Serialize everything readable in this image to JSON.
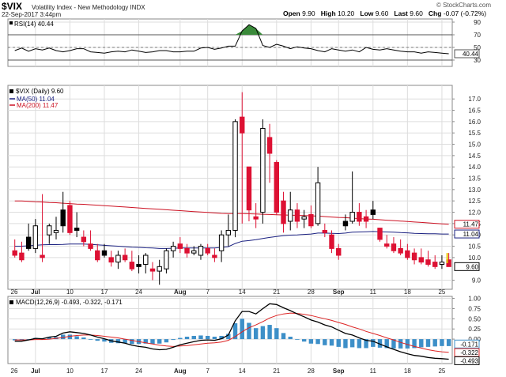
{
  "header": {
    "symbol": "$VIX",
    "company": "Volatility Index - New Methodology  INDX",
    "date": "22-Sep-2017 3:44pm",
    "brand": "© StockCharts.com",
    "open_label": "Open",
    "open": "9.90",
    "high_label": "High",
    "high": "10.20",
    "low_label": "Low",
    "low": "9.60",
    "last_label": "Last",
    "last": "9.60",
    "chg_label": "Chg",
    "chg": "-0.07 (-0.72%)"
  },
  "colors": {
    "up_candle": "#ffffff",
    "down_candle": "#dd1133",
    "black_candle": "#000000",
    "ma50": "#1a2080",
    "ma200": "#cc1122",
    "macd_line": "#000000",
    "signal_line": "#dd2222",
    "histogram": "#3d8fc8",
    "rsi_overbought_fill": "#3a8a3a",
    "grid": "#dddddd"
  },
  "chart_data": [
    {
      "type": "line",
      "panel": "rsi",
      "legend": "RSI(14) 40.44",
      "last_value_label": "40.44",
      "ylim": [
        20,
        95
      ],
      "y_ticks": [
        30,
        50,
        70,
        90
      ],
      "values": [
        45,
        49,
        44,
        48,
        46,
        49,
        45,
        43,
        45,
        48,
        48,
        43,
        42,
        41,
        43,
        44,
        43,
        46,
        44,
        42,
        43,
        45,
        45,
        43,
        43,
        44,
        44,
        49,
        50,
        47,
        49,
        52,
        52,
        76,
        86,
        80,
        53,
        50,
        55,
        52,
        48,
        51,
        49,
        48,
        45,
        43,
        48,
        46,
        44,
        46,
        43,
        50,
        47,
        46,
        48,
        46,
        44,
        43,
        43,
        41,
        43,
        42,
        41,
        40
      ]
    },
    {
      "type": "candlestick",
      "panel": "price",
      "legend": [
        "$VIX (Daily) 9.60",
        "MA(50) 11.04",
        "MA(200) 11.47"
      ],
      "last_value_labels": [
        "11.47",
        "11.04",
        "9.60"
      ],
      "ylim": [
        8.6,
        17.6
      ],
      "y_ticks": [
        9.0,
        10.0,
        10.5,
        11.0,
        11.5,
        12.0,
        12.5,
        13.0,
        13.5,
        14.0,
        14.5,
        15.0,
        15.5,
        16.0,
        16.5,
        17.0
      ],
      "ohlc": [
        [
          10.3,
          10.8,
          10.0,
          10.1
        ],
        [
          10.2,
          10.7,
          9.8,
          9.9
        ],
        [
          10.9,
          11.5,
          10.3,
          10.4
        ],
        [
          10.4,
          11.7,
          10.2,
          11.4
        ],
        [
          10.1,
          12.8,
          9.8,
          10.0
        ],
        [
          11.0,
          11.5,
          10.6,
          11.4
        ],
        [
          11.1,
          11.8,
          10.8,
          11.2
        ],
        [
          12.1,
          12.9,
          11.1,
          11.4
        ],
        [
          12.3,
          12.5,
          11.0,
          11.1
        ],
        [
          11.3,
          12.0,
          10.9,
          11.2
        ],
        [
          10.9,
          11.2,
          10.5,
          10.7
        ],
        [
          10.6,
          11.2,
          10.3,
          10.4
        ],
        [
          10.3,
          10.6,
          9.8,
          9.9
        ],
        [
          10.3,
          10.6,
          10.0,
          10.1
        ],
        [
          10.0,
          10.3,
          9.6,
          9.8
        ],
        [
          9.8,
          10.3,
          9.5,
          10.1
        ],
        [
          10.1,
          10.4,
          9.8,
          9.9
        ],
        [
          9.8,
          10.3,
          9.4,
          9.5
        ],
        [
          9.7,
          10.1,
          9.3,
          9.6
        ],
        [
          9.7,
          10.2,
          9.3,
          10.1
        ],
        [
          9.5,
          9.8,
          9.0,
          9.4
        ],
        [
          9.4,
          9.9,
          8.8,
          9.6
        ],
        [
          9.5,
          10.4,
          9.3,
          10.3
        ],
        [
          10.3,
          10.7,
          10.0,
          10.5
        ],
        [
          10.6,
          10.9,
          10.2,
          10.4
        ],
        [
          10.4,
          10.6,
          10.0,
          10.2
        ],
        [
          10.2,
          10.5,
          10.1,
          10.3
        ],
        [
          10.1,
          10.6,
          9.9,
          10.5
        ],
        [
          10.4,
          10.6,
          10.1,
          10.2
        ],
        [
          10.1,
          10.4,
          9.8,
          10.0
        ],
        [
          10.3,
          11.2,
          9.8,
          11.0
        ],
        [
          11.0,
          11.9,
          10.5,
          11.2
        ],
        [
          11.2,
          16.1,
          10.9,
          16.0
        ],
        [
          16.2,
          17.3,
          11.5,
          15.5
        ],
        [
          14.0,
          14.0,
          11.6,
          12.1
        ],
        [
          11.8,
          12.4,
          11.3,
          11.7
        ],
        [
          12.0,
          16.1,
          11.5,
          15.7
        ],
        [
          15.3,
          15.9,
          13.3,
          14.6
        ],
        [
          14.2,
          14.3,
          11.9,
          12.0
        ],
        [
          12.5,
          12.9,
          11.1,
          11.5
        ],
        [
          11.6,
          12.9,
          11.2,
          12.1
        ],
        [
          12.1,
          12.4,
          11.3,
          11.6
        ],
        [
          11.7,
          12.1,
          11.3,
          11.8
        ],
        [
          11.9,
          12.3,
          11.3,
          11.4
        ],
        [
          11.5,
          14.0,
          11.4,
          13.3
        ],
        [
          11.2,
          11.5,
          10.9,
          11.1
        ],
        [
          11.0,
          11.2,
          10.2,
          10.4
        ],
        [
          10.4,
          10.6,
          9.9,
          10.1
        ],
        [
          11.6,
          11.9,
          11.2,
          11.4
        ],
        [
          11.6,
          13.8,
          11.5,
          12.0
        ],
        [
          12.0,
          12.4,
          11.4,
          11.6
        ],
        [
          11.8,
          12.1,
          11.3,
          11.6
        ],
        [
          12.1,
          12.5,
          11.7,
          11.9
        ],
        [
          11.3,
          11.3,
          10.7,
          10.8
        ],
        [
          10.6,
          11.0,
          10.4,
          10.5
        ],
        [
          10.6,
          10.9,
          10.2,
          10.3
        ],
        [
          10.4,
          10.8,
          10.1,
          10.2
        ],
        [
          10.3,
          10.6,
          9.9,
          10.0
        ],
        [
          10.2,
          10.4,
          9.7,
          9.9
        ],
        [
          10.0,
          10.4,
          9.7,
          9.8
        ],
        [
          9.9,
          10.3,
          9.6,
          9.7
        ],
        [
          9.8,
          10.1,
          9.5,
          9.6
        ],
        [
          9.7,
          10.1,
          9.5,
          9.8
        ],
        [
          9.9,
          10.2,
          9.6,
          9.6
        ]
      ],
      "ma50": [
        10.5,
        10.5,
        10.52,
        10.54,
        10.56,
        10.57,
        10.57,
        10.58,
        10.6,
        10.6,
        10.6,
        10.58,
        10.56,
        10.54,
        10.52,
        10.5,
        10.48,
        10.46,
        10.45,
        10.43,
        10.42,
        10.4,
        10.4,
        10.41,
        10.42,
        10.42,
        10.42,
        10.42,
        10.42,
        10.42,
        10.45,
        10.48,
        10.62,
        10.72,
        10.75,
        10.79,
        10.84,
        10.89,
        10.93,
        10.97,
        10.99,
        11.0,
        11.02,
        11.04,
        11.08,
        11.08,
        11.07,
        11.06,
        11.08,
        11.12,
        11.13,
        11.14,
        11.15,
        11.14,
        11.13,
        11.12,
        11.1,
        11.09,
        11.07,
        11.06,
        11.05,
        11.05,
        11.04,
        11.04
      ],
      "ma200": [
        12.5,
        12.5,
        12.48,
        12.46,
        12.45,
        12.43,
        12.42,
        12.4,
        12.38,
        12.36,
        12.35,
        12.33,
        12.31,
        12.29,
        12.27,
        12.25,
        12.23,
        12.21,
        12.19,
        12.17,
        12.15,
        12.13,
        12.11,
        12.09,
        12.07,
        12.05,
        12.03,
        12.01,
        11.99,
        11.97,
        11.95,
        11.94,
        11.94,
        11.94,
        11.93,
        11.92,
        11.91,
        11.9,
        11.89,
        11.88,
        11.87,
        11.86,
        11.85,
        11.84,
        11.83,
        11.81,
        11.79,
        11.77,
        11.76,
        11.74,
        11.72,
        11.7,
        11.69,
        11.67,
        11.65,
        11.63,
        11.61,
        11.59,
        11.57,
        11.55,
        11.53,
        11.51,
        11.49,
        11.47
      ]
    },
    {
      "type": "line",
      "panel": "macd",
      "legend": "MACD(12,26,9) -0.493, -0.322, -0.171",
      "last_value_labels": [
        "-0.171",
        "-0.322",
        "-0.493"
      ],
      "ylim": [
        -0.6,
        1.05
      ],
      "y_ticks": [
        0.0,
        0.25,
        0.5,
        0.75,
        1.0
      ],
      "series": [
        {
          "name": "MACD",
          "values": [
            -0.05,
            -0.05,
            -0.02,
            0.02,
            0.01,
            0.05,
            0.07,
            0.15,
            0.18,
            0.16,
            0.14,
            0.1,
            0.05,
            0.01,
            -0.04,
            -0.07,
            -0.1,
            -0.15,
            -0.18,
            -0.2,
            -0.24,
            -0.26,
            -0.25,
            -0.2,
            -0.14,
            -0.1,
            -0.06,
            -0.03,
            -0.02,
            -0.03,
            0.01,
            0.1,
            0.45,
            0.68,
            0.68,
            0.62,
            0.75,
            0.87,
            0.85,
            0.77,
            0.7,
            0.62,
            0.55,
            0.47,
            0.42,
            0.35,
            0.3,
            0.22,
            0.14,
            0.1,
            0.03,
            -0.03,
            -0.05,
            -0.12,
            -0.19,
            -0.25,
            -0.31,
            -0.36,
            -0.4,
            -0.42,
            -0.45,
            -0.47,
            -0.48,
            -0.493
          ]
        },
        {
          "name": "Signal",
          "values": [
            -0.02,
            -0.02,
            -0.02,
            -0.01,
            -0.01,
            0.0,
            0.02,
            0.04,
            0.07,
            0.09,
            0.1,
            0.1,
            0.09,
            0.07,
            0.05,
            0.03,
            0.0,
            -0.03,
            -0.06,
            -0.09,
            -0.12,
            -0.15,
            -0.17,
            -0.18,
            -0.17,
            -0.16,
            -0.14,
            -0.12,
            -0.1,
            -0.09,
            -0.07,
            -0.03,
            0.06,
            0.18,
            0.28,
            0.35,
            0.43,
            0.52,
            0.58,
            0.62,
            0.64,
            0.63,
            0.61,
            0.58,
            0.54,
            0.5,
            0.46,
            0.41,
            0.36,
            0.3,
            0.25,
            0.19,
            0.14,
            0.09,
            0.03,
            -0.02,
            -0.08,
            -0.13,
            -0.18,
            -0.22,
            -0.26,
            -0.29,
            -0.31,
            -0.322
          ]
        },
        {
          "name": "Histogram",
          "values": [
            -0.03,
            -0.03,
            0.0,
            0.03,
            0.02,
            0.05,
            0.05,
            0.11,
            0.11,
            0.07,
            0.04,
            0.0,
            -0.04,
            -0.06,
            -0.09,
            -0.1,
            -0.1,
            -0.12,
            -0.12,
            -0.11,
            -0.12,
            -0.11,
            -0.08,
            -0.02,
            0.03,
            0.06,
            0.08,
            0.09,
            0.08,
            0.06,
            0.08,
            0.13,
            0.39,
            0.5,
            0.4,
            0.27,
            0.32,
            0.35,
            0.27,
            0.15,
            0.06,
            -0.01,
            -0.06,
            -0.11,
            -0.12,
            -0.15,
            -0.16,
            -0.19,
            -0.22,
            -0.2,
            -0.22,
            -0.22,
            -0.19,
            -0.21,
            -0.22,
            -0.23,
            -0.23,
            -0.23,
            -0.22,
            -0.2,
            -0.19,
            -0.18,
            -0.17,
            -0.171
          ]
        }
      ]
    }
  ],
  "x_axis": {
    "labels": [
      {
        "text": "26",
        "index": -1
      },
      {
        "text": "Jul",
        "index": 3,
        "bold": true
      },
      {
        "text": "10",
        "index": 8
      },
      {
        "text": "17",
        "index": 13
      },
      {
        "text": "24",
        "index": 18
      },
      {
        "text": "Aug",
        "index": 24,
        "bold": true
      },
      {
        "text": "7",
        "index": 28
      },
      {
        "text": "14",
        "index": 33
      },
      {
        "text": "21",
        "index": 38
      },
      {
        "text": "28",
        "index": 43
      },
      {
        "text": "Sep",
        "index": 47,
        "bold": true
      },
      {
        "text": "11",
        "index": 52
      },
      {
        "text": "18",
        "index": 57
      },
      {
        "text": "25",
        "index": 62
      }
    ]
  }
}
